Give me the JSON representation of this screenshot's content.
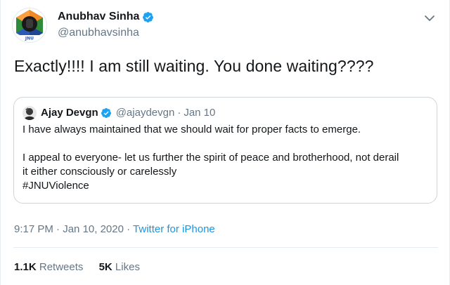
{
  "author": {
    "display_name": "Anubhav Sinha",
    "username": "@anubhavsinha",
    "avatar_text": "JNU",
    "verified_icon": "verified-badge-icon"
  },
  "tweet": {
    "text": "Exactly!!!! I am still waiting. You done waiting????"
  },
  "quoted": {
    "display_name": "Ajay Devgn",
    "username": "@ajaydevgn",
    "separator": "·",
    "date": "Jan 10",
    "line1": "I have always maintained that we should wait for proper facts to emerge.",
    "line2": "I appeal to everyone- let us further the spirit of peace and brotherhood, not derail",
    "line3": "it either consciously or carelessly",
    "hashtag": "#JNUViolence"
  },
  "meta": {
    "time": "9:17 PM",
    "separator1": "·",
    "date": "Jan 10, 2020",
    "separator2": "·",
    "source": "Twitter for iPhone"
  },
  "stats": {
    "retweets_count": "1.1K",
    "retweets_label": "Retweets",
    "likes_count": "5K",
    "likes_label": "Likes"
  },
  "colors": {
    "link": "#1b95e0",
    "verified": "#1da1f2",
    "muted": "#657786",
    "text": "#14171a"
  }
}
